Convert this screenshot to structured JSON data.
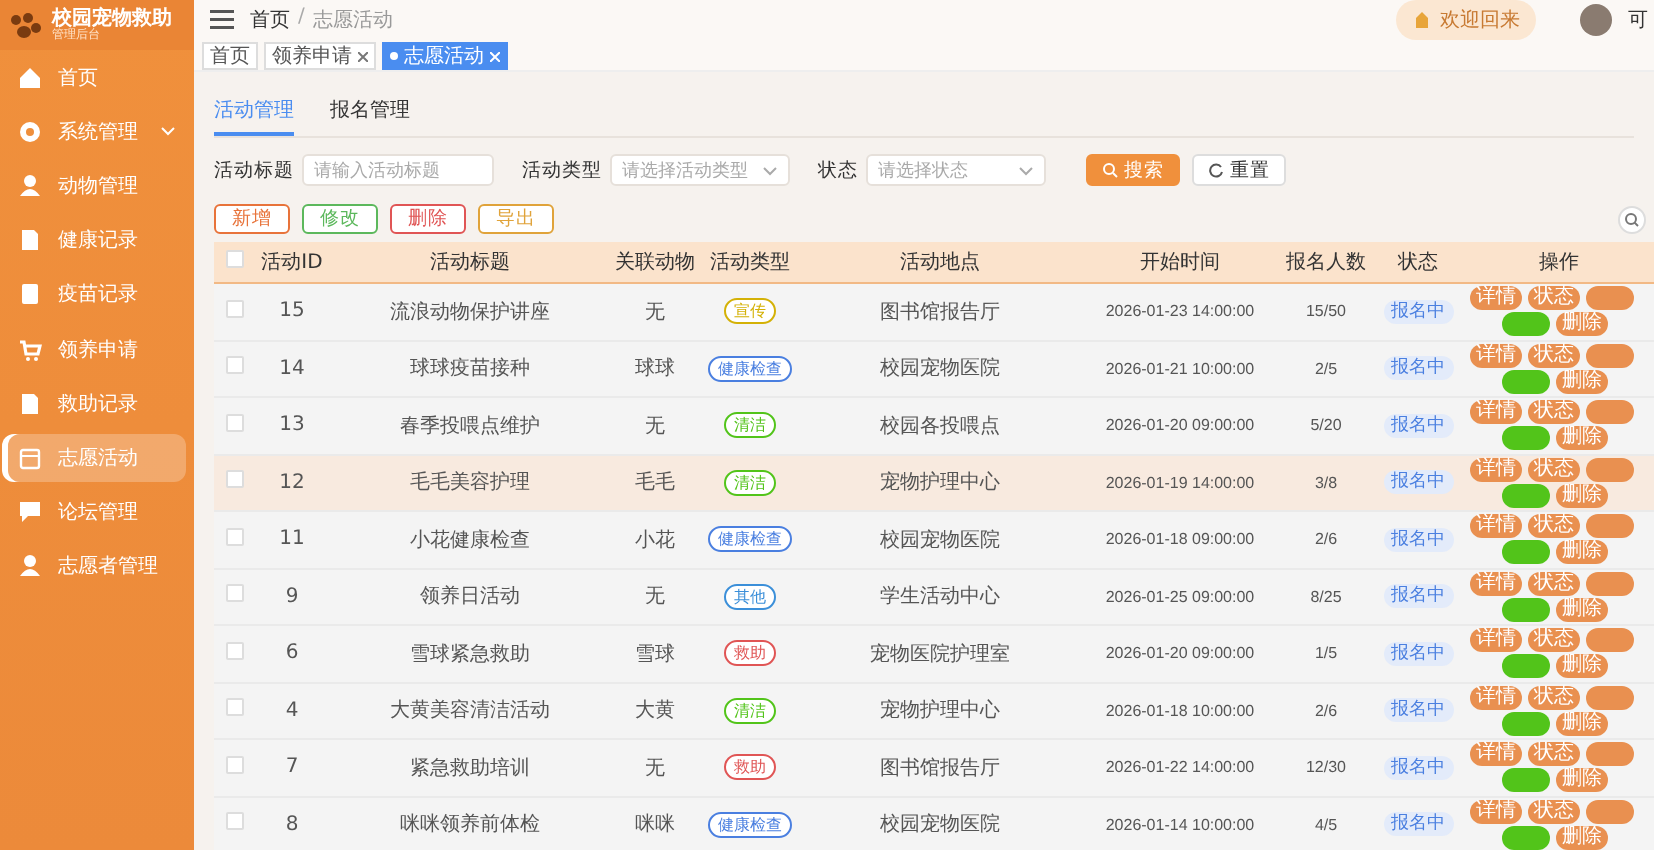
{
  "brand": {
    "title": "校园宠物救助",
    "subtitle": "管理后台"
  },
  "sidebar": {
    "items": [
      {
        "label": "首页",
        "selected": false,
        "expandable": false
      },
      {
        "label": "系统管理",
        "selected": false,
        "expandable": true
      },
      {
        "label": "动物管理",
        "selected": false,
        "expandable": false
      },
      {
        "label": "健康记录",
        "selected": false,
        "expandable": false
      },
      {
        "label": "疫苗记录",
        "selected": false,
        "expandable": false
      },
      {
        "label": "领养申请",
        "selected": false,
        "expandable": false
      },
      {
        "label": "救助记录",
        "selected": false,
        "expandable": false
      },
      {
        "label": "志愿活动",
        "selected": true,
        "expandable": false
      },
      {
        "label": "论坛管理",
        "selected": false,
        "expandable": false
      },
      {
        "label": "志愿者管理",
        "selected": false,
        "expandable": false
      }
    ]
  },
  "header": {
    "breadcrumb": [
      "首页",
      "志愿活动"
    ],
    "separator": "/",
    "welcome": "欢迎回来",
    "user": "可"
  },
  "page_tabs": [
    {
      "label": "首页",
      "selected": false,
      "closable": false
    },
    {
      "label": "领养申请",
      "selected": false,
      "closable": true
    },
    {
      "label": "志愿活动",
      "selected": true,
      "closable": true
    }
  ],
  "sub_tabs": [
    {
      "label": "活动管理",
      "selected": true
    },
    {
      "label": "报名管理",
      "selected": false
    }
  ],
  "filters": [
    {
      "label": "活动标题",
      "kind": "input",
      "placeholder": "请输入活动标题"
    },
    {
      "label": "活动类型",
      "kind": "select",
      "placeholder": "请选择活动类型"
    },
    {
      "label": "状态",
      "kind": "select",
      "placeholder": "请选择状态"
    }
  ],
  "search_buttons": [
    {
      "label": "搜索",
      "kind": "primary"
    },
    {
      "label": "重置",
      "kind": "plain"
    }
  ],
  "toolbar": [
    {
      "label": "新增",
      "color": "#e8733a"
    },
    {
      "label": "修改",
      "color": "#5cb85c"
    },
    {
      "label": "删除",
      "color": "#e05555"
    },
    {
      "label": "导出",
      "color": "#e0a33a"
    }
  ],
  "table": {
    "all_checked": false,
    "columns": [
      "活动ID",
      "活动标题",
      "关联动物",
      "活动类型",
      "活动地点",
      "开始时间",
      "报名人数",
      "状态",
      "操作"
    ],
    "rows": [
      {
        "checked": false,
        "id": "15",
        "title": "流浪动物保护讲座",
        "animal": "无",
        "type": "宣传",
        "color": "#d4b106",
        "place": "图书馆报告厅",
        "start": "2026-01-23 14:00:00",
        "count": "15/50",
        "status": "报名中",
        "hovered": false,
        "actions": [
          "详情",
          "状态",
          "删除"
        ]
      },
      {
        "checked": false,
        "id": "14",
        "title": "球球疫苗接种",
        "animal": "球球",
        "type": "健康检查",
        "color": "#4a7fe0",
        "place": "校园宠物医院",
        "start": "2026-01-21 10:00:00",
        "count": "2/5",
        "status": "报名中",
        "hovered": false,
        "actions": [
          "详情",
          "状态",
          "删除"
        ]
      },
      {
        "checked": false,
        "id": "13",
        "title": "春季投喂点维护",
        "animal": "无",
        "type": "清洁",
        "color": "#52c41a",
        "place": "校园各投喂点",
        "start": "2026-01-20 09:00:00",
        "count": "5/20",
        "status": "报名中",
        "hovered": false,
        "actions": [
          "详情",
          "状态",
          "删除"
        ]
      },
      {
        "checked": false,
        "id": "12",
        "title": "毛毛美容护理",
        "animal": "毛毛",
        "type": "清洁",
        "color": "#52c41a",
        "place": "宠物护理中心",
        "start": "2026-01-19 14:00:00",
        "count": "3/8",
        "status": "报名中",
        "hovered": true,
        "actions": [
          "详情",
          "状态",
          "删除"
        ]
      },
      {
        "checked": false,
        "id": "11",
        "title": "小花健康检查",
        "animal": "小花",
        "type": "健康检查",
        "color": "#4a7fe0",
        "place": "校园宠物医院",
        "start": "2026-01-18 09:00:00",
        "count": "2/6",
        "status": "报名中",
        "hovered": false,
        "actions": [
          "详情",
          "状态",
          "删除"
        ]
      },
      {
        "checked": false,
        "id": "9",
        "title": "领养日活动",
        "animal": "无",
        "type": "其他",
        "color": "#3b8fd9",
        "place": "学生活动中心",
        "start": "2026-01-25 09:00:00",
        "count": "8/25",
        "status": "报名中",
        "hovered": false,
        "actions": [
          "详情",
          "状态",
          "删除"
        ]
      },
      {
        "checked": false,
        "id": "6",
        "title": "雪球紧急救助",
        "animal": "雪球",
        "type": "救助",
        "color": "#e05555",
        "place": "宠物医院护理室",
        "start": "2026-01-20 09:00:00",
        "count": "1/5",
        "status": "报名中",
        "hovered": false,
        "actions": [
          "详情",
          "状态",
          "删除"
        ]
      },
      {
        "checked": false,
        "id": "4",
        "title": "大黄美容清洁活动",
        "animal": "大黄",
        "type": "清洁",
        "color": "#52c41a",
        "place": "宠物护理中心",
        "start": "2026-01-18 10:00:00",
        "count": "2/6",
        "status": "报名中",
        "hovered": false,
        "actions": [
          "详情",
          "状态",
          "删除"
        ]
      },
      {
        "checked": false,
        "id": "7",
        "title": "紧急救助培训",
        "animal": "无",
        "type": "救助",
        "color": "#e05555",
        "place": "图书馆报告厅",
        "start": "2026-01-22 14:00:00",
        "count": "12/30",
        "status": "报名中",
        "hovered": false,
        "actions": [
          "详情",
          "状态",
          "删除"
        ]
      },
      {
        "checked": false,
        "id": "8",
        "title": "咪咪领养前体检",
        "animal": "咪咪",
        "type": "健康检查",
        "color": "#4a7fe0",
        "place": "校园宠物医院",
        "start": "2026-01-14 10:00:00",
        "count": "4/5",
        "status": "报名中",
        "hovered": false,
        "actions": [
          "详情",
          "状态",
          "删除"
        ]
      }
    ]
  }
}
